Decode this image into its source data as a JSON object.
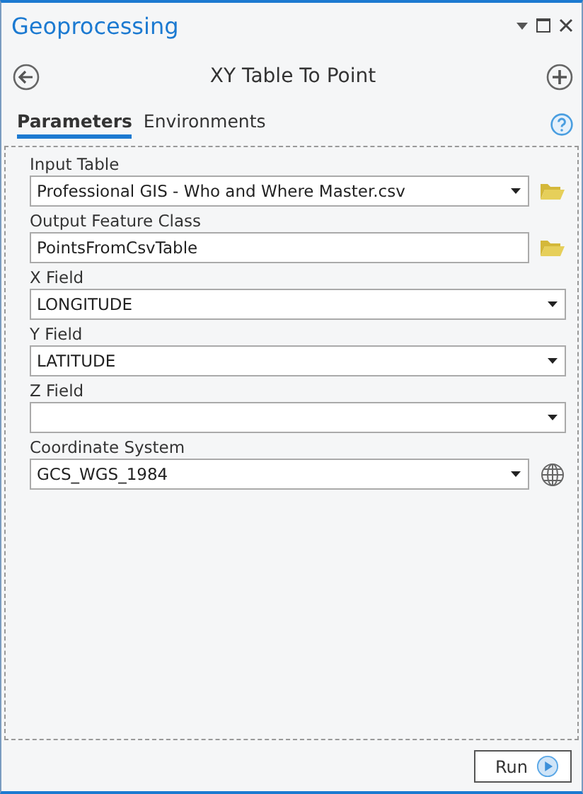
{
  "window": {
    "title": "Geoprocessing"
  },
  "tool": {
    "title": "XY Table To Point"
  },
  "tabs": [
    {
      "label": "Parameters",
      "selected": true
    },
    {
      "label": "Environments",
      "selected": false
    }
  ],
  "parameters": [
    {
      "label": "Input Table",
      "kind": "dropdown",
      "value": "Professional GIS - Who and Where Master.csv",
      "action": {
        "kind": "folder"
      }
    },
    {
      "label": "Output Feature Class",
      "kind": "text",
      "value": "PointsFromCsvTable",
      "action": {
        "kind": "folder"
      }
    },
    {
      "label": "X Field",
      "kind": "dropdown",
      "value": "LONGITUDE"
    },
    {
      "label": "Y Field",
      "kind": "dropdown",
      "value": "LATITUDE"
    },
    {
      "label": "Z Field",
      "kind": "dropdown"
    },
    {
      "label": "Coordinate System",
      "kind": "dropdown",
      "value": "GCS_WGS_1984",
      "action": {
        "kind": "globe"
      }
    }
  ],
  "run_button": {
    "label": "Run"
  }
}
